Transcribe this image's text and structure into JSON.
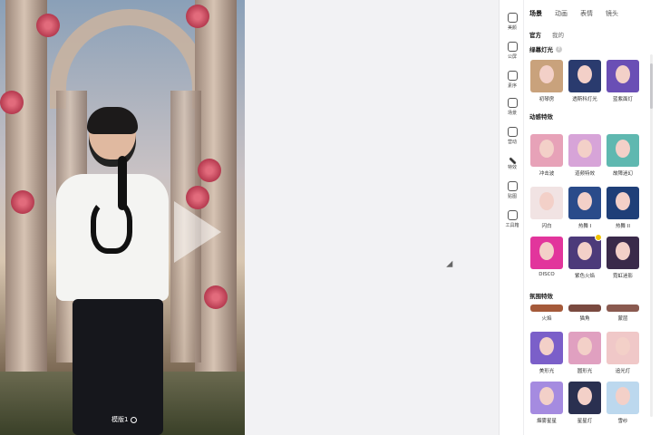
{
  "preview": {
    "template_label": "模版1"
  },
  "rail": [
    {
      "label": "美颜",
      "icon": "face-icon"
    },
    {
      "label": "公屏",
      "icon": "chat-icon"
    },
    {
      "label": "素序",
      "icon": "list-icon"
    },
    {
      "label": "场景",
      "icon": "layers-icon"
    },
    {
      "label": "营动",
      "icon": "activity-icon"
    },
    {
      "label": "特效",
      "icon": "magic-wand-icon"
    },
    {
      "label": "贴图",
      "icon": "image-icon"
    },
    {
      "label": "工具箱",
      "icon": "toolbox-icon"
    }
  ],
  "panel": {
    "tabs": [
      "场景",
      "动画",
      "表情",
      "镜头"
    ],
    "subtabs": [
      "官方",
      "我的"
    ],
    "sections": [
      {
        "title": "绿幕灯光",
        "items": [
          {
            "name": "初琴房",
            "bg": "#c9a27c"
          },
          {
            "name": "透斯科灯光",
            "bg": "#2a3b6e"
          },
          {
            "name": "蓝紫面灯",
            "bg": "#6a4fb5"
          }
        ]
      },
      {
        "title": "动感特效",
        "items": [
          {
            "name": "冲击波",
            "bg": "#e7a2b8"
          },
          {
            "name": "道频特效",
            "bg": "#d7a4d8"
          },
          {
            "name": "故障迷幻",
            "bg": "#5fb8b0"
          },
          {
            "name": "闪白",
            "bg": "#f1e3e3"
          },
          {
            "name": "热舞 I",
            "bg": "#2a4b8a"
          },
          {
            "name": "热舞 II",
            "bg": "#1f3f78"
          },
          {
            "name": "DISCO",
            "bg": "#e2359c"
          },
          {
            "name": "紫色火焰",
            "bg": "#4c3a7a"
          },
          {
            "name": "霓虹迷影",
            "bg": "#3a2a4a"
          }
        ]
      },
      {
        "title": "氛围特效",
        "items": [
          {
            "name": "火焰",
            "bg": "#a55a3a"
          },
          {
            "name": "猫角",
            "bg": "#7a4a40"
          },
          {
            "name": "蒙层",
            "bg": "#8a5a50"
          },
          {
            "name": "美形光",
            "bg": "#7b5fc9"
          },
          {
            "name": "圆形光",
            "bg": "#e0a0c0"
          },
          {
            "name": "追光灯",
            "bg": "#f0c8c8"
          },
          {
            "name": "烟雾星星",
            "bg": "#a58be0"
          },
          {
            "name": "星星灯",
            "bg": "#2a3050"
          },
          {
            "name": "雪纱",
            "bg": "#bcd8ee"
          }
        ]
      }
    ]
  },
  "colors": {
    "accent": "#f2c300",
    "panel_bg": "#ffffff",
    "canvas_bg": "#f2f2f4"
  }
}
